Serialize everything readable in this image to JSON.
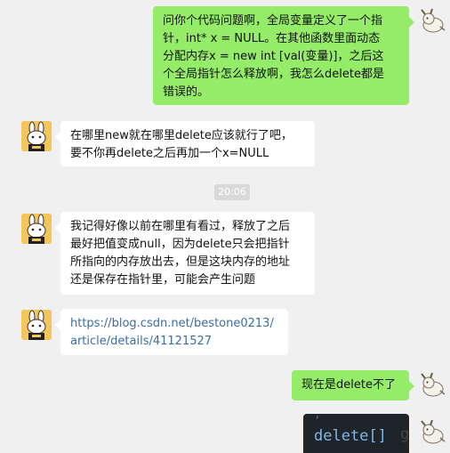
{
  "messages": [
    {
      "side": "sent",
      "lines": [
        "问你个代码问题啊，全局变量定义了一个指",
        "针，int* x = NULL。在其他函数里面动态",
        "分配内存x = new int [val(变量)]，之后这",
        "个全局指针怎么释放啊，我怎么delete都是",
        "错误的。"
      ]
    },
    {
      "side": "recv",
      "lines": [
        "在哪里new就在哪里delete应该就行了吧，",
        "要不你再delete之后再加一个x=NULL"
      ]
    },
    {
      "side": "recv",
      "lines": [
        "我记得好像以前在哪里有看过，释放了之后",
        "最好把值变成null，因为delete只会把指针",
        "所指向的内存放出去，但是这块内存的地址",
        "还是保存在指针里，可能会产生问题"
      ]
    },
    {
      "side": "recv",
      "link": true,
      "lines": [
        "https://blog.csdn.net/bestone0213/",
        "article/details/41121527"
      ]
    },
    {
      "side": "sent",
      "lines": [
        "现在是delete不了"
      ]
    }
  ],
  "timestamp": "20:06",
  "code_snippet": {
    "text": "delete[]",
    "overflow": "g"
  },
  "colors": {
    "background": "#f0f0f0",
    "sent_bubble": "#95ec69",
    "recv_bubble": "#ffffff",
    "link": "#3a6ea5",
    "code_bg": "#1f2429",
    "code_fg": "#7db7e9"
  },
  "icons": {
    "left_avatar": "cartoon-bunny-avatar-icon",
    "right_avatar": "cartoon-goat-avatar-icon"
  }
}
